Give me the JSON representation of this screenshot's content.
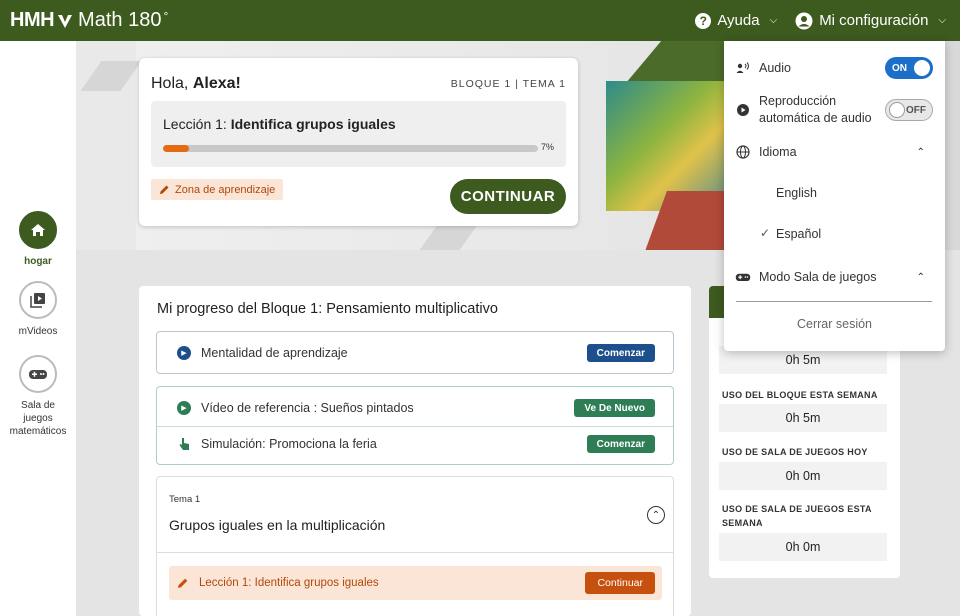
{
  "header": {
    "brand_hmh": "HMH",
    "brand_product": "Math 180",
    "brand_mark": "°",
    "help_label": "Ayuda",
    "settings_label": "Mi configuración"
  },
  "rail": {
    "items": [
      {
        "label": "hogar",
        "icon": "home-icon",
        "active": true
      },
      {
        "label": "mVideos",
        "icon": "video-library-icon",
        "active": false
      },
      {
        "label": "Sala de juegos matemáticos",
        "icon": "gamepad-icon",
        "active": false
      }
    ]
  },
  "greeting": {
    "hello_prefix": "Hola,",
    "name": "Alexa!",
    "bloque": "BLOQUE 1 | TEMA 1",
    "lesson_prefix": "Lección 1:",
    "lesson_title": "Identifica grupos iguales",
    "progress_percent": 7,
    "progress_label": "7%",
    "zone_label": "Zona de aprendizaje",
    "continue_label": "CONTINUAR"
  },
  "progress_card": {
    "title": "Mi progreso del Bloque 1: Pensamiento multiplicativo",
    "item1": {
      "label": "Mentalidad de aprendizaje",
      "button": "Comenzar"
    },
    "item2": {
      "label": "Vídeo de referencia : Sueños pintados",
      "button": "Ve De Nuevo"
    },
    "item3": {
      "label": "Simulación: Promociona la feria",
      "button": "Comenzar"
    },
    "tema": {
      "small": "Tema 1",
      "name": "Grupos iguales en la multiplicación",
      "lesson": "Lección 1: Identifica grupos iguales",
      "lesson_button": "Continuar"
    }
  },
  "stats": {
    "items": [
      {
        "label": "",
        "value": "0h 5m"
      },
      {
        "label": "USO DEL BLOQUE ESTA SEMANA",
        "value": "0h 5m"
      },
      {
        "label": "USO DE SALA DE JUEGOS HOY",
        "value": "0h 0m"
      },
      {
        "label": "USO DE SALA DE JUEGOS ESTA SEMANA",
        "value": "0h 0m"
      }
    ]
  },
  "menu": {
    "audio_label": "Audio",
    "audio_state": "ON",
    "autoplay_label": "Reproducción automática de audio",
    "autoplay_state": "OFF",
    "language_label": "Idioma",
    "languages": [
      "English",
      "Español"
    ],
    "selected_language": "Español",
    "arcade_label": "Modo Sala de juegos",
    "logout_label": "Cerrar sesión"
  },
  "colors": {
    "brand_green": "#3d5a1f",
    "accent_orange": "#e46a14",
    "toggle_on": "#1b6fc8",
    "pill_blue": "#1d4f8c",
    "pill_green": "#2e7d55"
  }
}
